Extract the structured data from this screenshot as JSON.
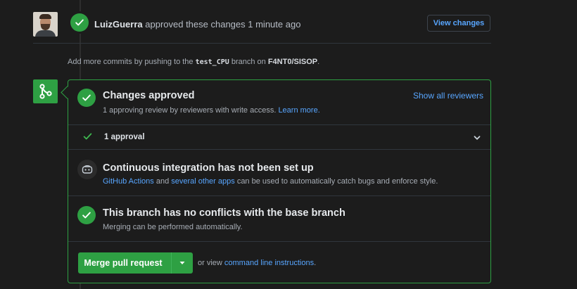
{
  "review": {
    "author": "LuizGuerra",
    "action": "approved these changes",
    "time": "1 minute ago",
    "view_changes_label": "View changes"
  },
  "commits_note": {
    "prefix": "Add more commits by pushing to the",
    "branch": "test_CPU",
    "middle": "branch on",
    "repo": "F4NT0/SISOP",
    "suffix": "."
  },
  "changes_approved": {
    "title": "Changes approved",
    "subtitle": "1 approving review by reviewers with write access.",
    "learn_more": "Learn more.",
    "show_all_reviewers": "Show all reviewers"
  },
  "approvals": {
    "label": "1 approval"
  },
  "ci": {
    "title": "Continuous integration has not been set up",
    "link1": "GitHub Actions",
    "and": "and",
    "link2": "several other apps",
    "rest": "can be used to automatically catch bugs and enforce style."
  },
  "conflicts": {
    "title": "This branch has no conflicts with the base branch",
    "subtitle": "Merging can be performed automatically."
  },
  "merge": {
    "button_label": "Merge pull request",
    "or_view": "or view",
    "cli_link": "command line instructions",
    "period": "."
  },
  "icons": {
    "review_status": "check-circle-icon",
    "merge": "git-merge-icon",
    "ci": "ci-bot-icon",
    "dropdown": "triangle-down-icon",
    "expand": "chevron-down-icon"
  },
  "colors": {
    "success": "#2ea043",
    "link": "#58a6ff",
    "background": "#1c1c1c",
    "border": "#30363d"
  }
}
